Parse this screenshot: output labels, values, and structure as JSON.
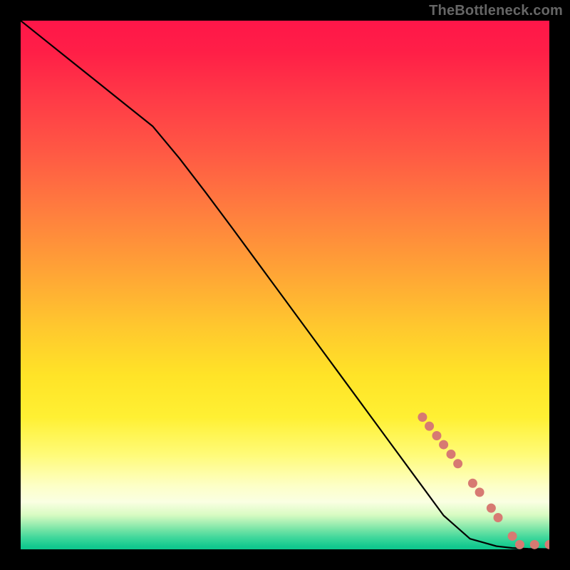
{
  "watermark": "TheBottleneck.com",
  "chart_data": {
    "type": "line",
    "title": "",
    "xlabel": "",
    "ylabel": "",
    "xlim": [
      0,
      100
    ],
    "ylim": [
      0,
      100
    ],
    "grid": false,
    "legend": false,
    "series": [
      {
        "name": "curve",
        "color": "#000000",
        "x": [
          0,
          5,
          10,
          15,
          20,
          25,
          30,
          35,
          40,
          45,
          50,
          55,
          60,
          65,
          70,
          75,
          80,
          85,
          90,
          93,
          96,
          100
        ],
        "y": [
          100,
          96,
          92,
          88,
          84,
          80,
          74,
          67.5,
          60.8,
          54,
          47.2,
          40.4,
          33.6,
          26.8,
          20,
          13.2,
          6.4,
          2.0,
          0.6,
          0.25,
          0.1,
          0.05
        ]
      }
    ],
    "markers": {
      "name": "dots",
      "color": "#d77a72",
      "radius_px": 6.5,
      "points": [
        {
          "x": 76.0,
          "y": 25.0
        },
        {
          "x": 77.3,
          "y": 23.3
        },
        {
          "x": 78.7,
          "y": 21.5
        },
        {
          "x": 80.0,
          "y": 19.8
        },
        {
          "x": 81.4,
          "y": 18.0
        },
        {
          "x": 82.7,
          "y": 16.2
        },
        {
          "x": 85.5,
          "y": 12.5
        },
        {
          "x": 86.8,
          "y": 10.8
        },
        {
          "x": 89.0,
          "y": 7.8
        },
        {
          "x": 90.3,
          "y": 6.0
        },
        {
          "x": 93.0,
          "y": 2.5
        },
        {
          "x": 94.4,
          "y": 0.9
        },
        {
          "x": 97.2,
          "y": 0.9
        },
        {
          "x": 100.0,
          "y": 0.9
        }
      ]
    }
  }
}
